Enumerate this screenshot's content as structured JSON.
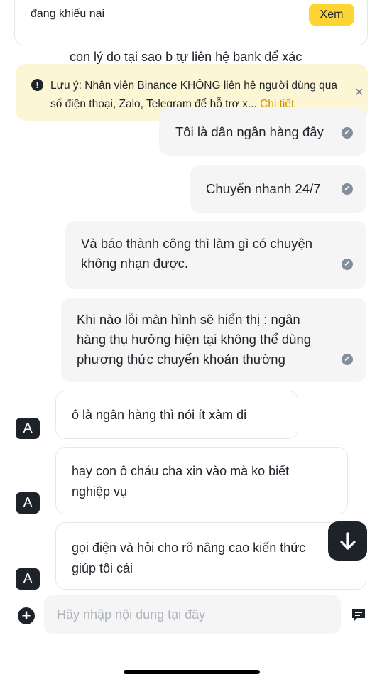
{
  "header_card": {
    "status": "đang khiếu nại",
    "view_button": "Xem"
  },
  "cut_message": "con lý do tại sao b tự liên hệ bank để xác",
  "notice": {
    "text": "Lưu ý: Nhân viên Binance KHÔNG liên hệ người dùng qua số điện thoại, Zalo, Telegram để hỗ trợ x...",
    "link": "Chi tiết",
    "warn_icon": "!",
    "close_icon": "×"
  },
  "outgoing": [
    {
      "text": "Tôi là dân ngân hàng đây"
    },
    {
      "text": "Chuyển nhanh 24/7"
    },
    {
      "lines": [
        "Và báo thành công thì làm gì có chuyện",
        "không nhạn được."
      ]
    },
    {
      "lines": [
        "Khi nào lỗi màn hình sẽ hiển thị : ngân",
        "hàng thụ hưởng hiện tại không thể dùng",
        "phương thức chuyển khoản thường"
      ]
    }
  ],
  "incoming": [
    {
      "avatar": "A",
      "lines": [
        "ô là ngân hàng thì nói ít xàm đi"
      ]
    },
    {
      "avatar": "A",
      "lines": [
        "hay con ô cháu cha xin vào mà ko biết",
        "nghiệp vụ"
      ]
    },
    {
      "avatar": "A",
      "lines": [
        "gọi điện và hỏi cho rõ nâng cao kiến thức",
        "giúp tôi cái"
      ]
    }
  ],
  "composer": {
    "placeholder": "Hãy nhập nội dung tại đây",
    "value": "",
    "plus_icon": "+"
  },
  "check_icon": "✓",
  "colors": {
    "accent": "#fcd535",
    "notice_bg": "#fdf6d5",
    "link": "#c99400",
    "bubble_bg": "#f5f5f5",
    "dark": "#1e2329"
  }
}
